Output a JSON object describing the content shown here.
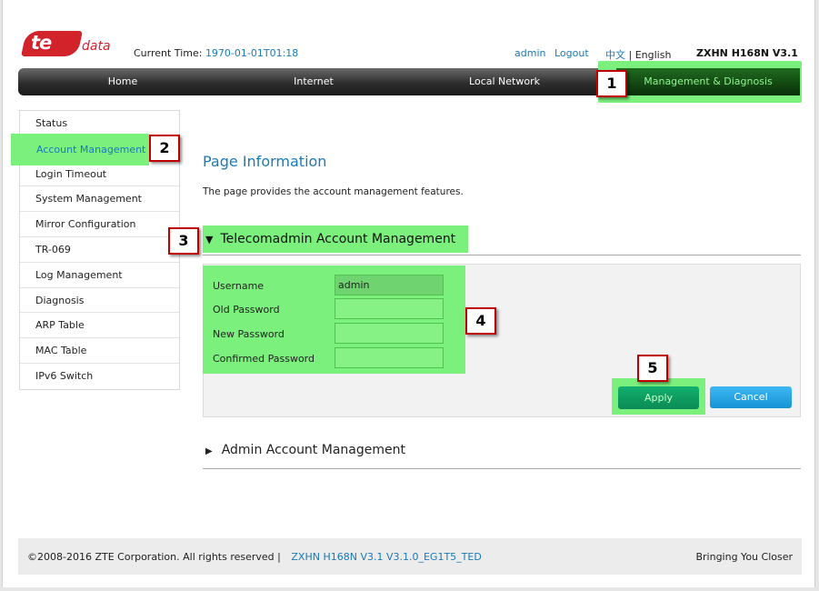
{
  "brand": {
    "logo_main": "te",
    "logo_sub": "data"
  },
  "header": {
    "current_time_label": "Current Time:",
    "current_time_value": "1970-01-01T01:18",
    "user": "admin",
    "logout": "Logout",
    "lang_zh": "中文",
    "lang_sep": "|",
    "lang_en": "English",
    "model": "ZXHN H168N V3.1"
  },
  "nav": {
    "home": "Home",
    "internet": "Internet",
    "local_network": "Local Network",
    "management": "Management & Diagnosis"
  },
  "sidebar": {
    "items": [
      "Status",
      "Account Management",
      "Login Timeout",
      "System Management",
      "Mirror Configuration",
      "TR-069",
      "Log Management",
      "Diagnosis",
      "ARP Table",
      "MAC Table",
      "IPv6 Switch"
    ],
    "active": "Account Management"
  },
  "main": {
    "title": "Page Information",
    "description": "The page provides the account management features.",
    "telecom_section": "Telecomadmin Account Management",
    "form": {
      "username_label": "Username",
      "username_value": "admin",
      "old_password_label": "Old Password",
      "new_password_label": "New Password",
      "confirm_password_label": "Confirmed Password"
    },
    "apply": "Apply",
    "cancel": "Cancel",
    "admin_section": "Admin Account Management"
  },
  "callouts": {
    "c1": "1",
    "c2": "2",
    "c3": "3",
    "c4": "4",
    "c5": "5"
  },
  "footer": {
    "copyright": "©2008-2016 ZTE Corporation. All rights reserved",
    "separator": "|",
    "version": "ZXHN H168N V3.1 V3.1.0_EG1T5_TED",
    "slogan": "Bringing You Closer"
  },
  "colors": {
    "highlight": "#7cf07c",
    "link": "#1a7ab8",
    "callout_border": "#c00000"
  }
}
